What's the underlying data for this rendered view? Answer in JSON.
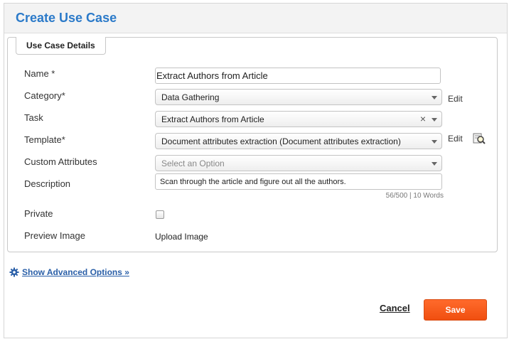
{
  "header": {
    "title": "Create Use Case"
  },
  "section": {
    "title": "Use Case Details"
  },
  "fields": {
    "name": {
      "label": "Name *",
      "value": "Extract Authors from Article"
    },
    "category": {
      "label": "Category*",
      "value": "Data Gathering",
      "edit_label": "Edit"
    },
    "task": {
      "label": "Task",
      "value": "Extract Authors from Article",
      "clear_glyph": "×"
    },
    "template": {
      "label": "Template*",
      "value": "Document attributes extraction (Document attributes extraction)",
      "edit_label": "Edit"
    },
    "custom_attributes": {
      "label": "Custom Attributes",
      "placeholder": "Select an Option"
    },
    "description": {
      "label": "Description",
      "value": "Scan through the article and figure out all the authors.",
      "counter": "56/500 | 10 Words"
    },
    "private": {
      "label": "Private",
      "checked": false
    },
    "preview_image": {
      "label": "Preview Image",
      "upload_label": "Upload Image"
    }
  },
  "advanced": {
    "label": "Show Advanced Options »"
  },
  "actions": {
    "cancel_label": "Cancel",
    "save_label": "Save"
  },
  "colors": {
    "title": "#2b7ac9",
    "link": "#2a5fa8",
    "save_button": "#f05a1a"
  },
  "icons": [
    "arrow-down-icon",
    "clear-icon",
    "preview-magnifier-icon",
    "gear-icon"
  ]
}
